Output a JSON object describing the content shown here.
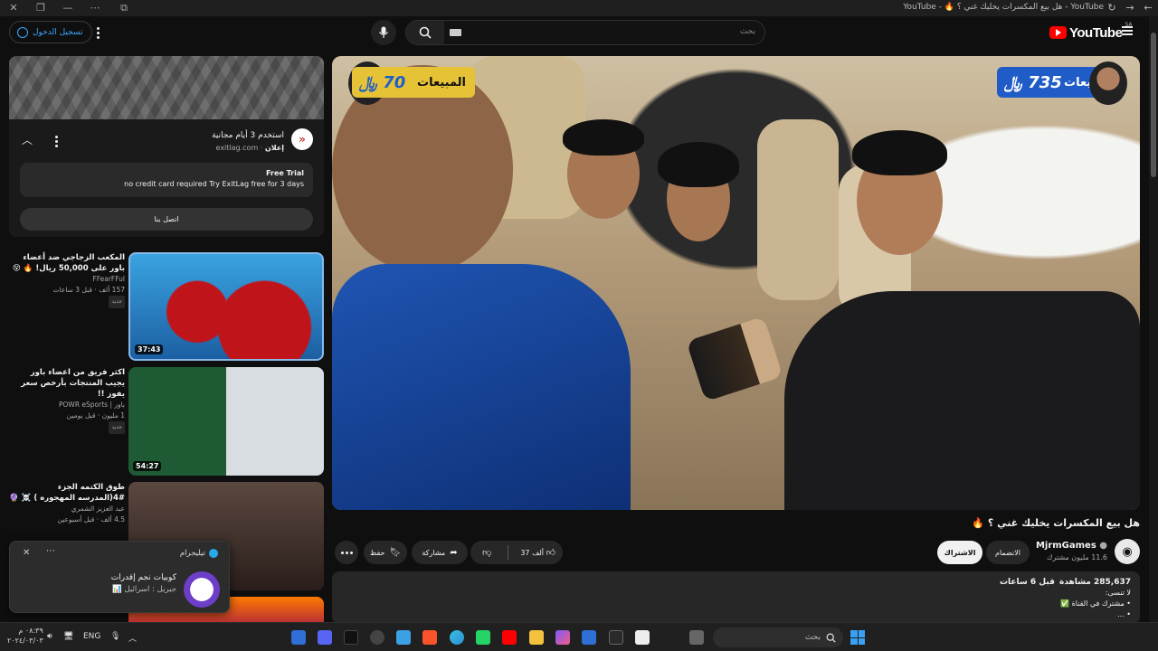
{
  "browser": {
    "tab_title": "YouTube - هل بيع المكسرات يخليك غني ؟ 🔥 - YouTube"
  },
  "masthead": {
    "signin_label": "تسجيل الدخول",
    "search_placeholder": "بحث",
    "logo_text": "YouTube",
    "logo_region": "SA"
  },
  "ad": {
    "headline": "استخدم 3 أيام مجانية",
    "sponsor_prefix": "إعلان",
    "domain": "exitlag.com",
    "trial_title": "Free Trial",
    "trial_text": "no credit card required Try ExitLag free for 3 days",
    "cta_label": "اتصل بنا"
  },
  "related": [
    {
      "title": "المكعب الزجاجي ضد أعضاء باور على 50,000 ريال! 🔥 😵",
      "channel": "FFearFFul",
      "views": "157 ألف",
      "age": "قبل 3 ساعات",
      "badge": "جديد",
      "duration": "37:43"
    },
    {
      "title": "اكثر فريق من اعضاء باور يجيب المنتجات بأرخص سعر يفوز !!",
      "channel": "باور | POWR eSports",
      "views": "1 مليون",
      "age": "قبل يومين",
      "badge": "جديد",
      "duration": "54:27"
    },
    {
      "title": "طوق الكتمه الجزء #4(المدرسه المهجوره ) ☠️ 🔮",
      "channel": "عبد العزيز الشمري",
      "views": "4.5 ألف",
      "age": "قبل أسبوعين",
      "badge": "",
      "duration": ""
    }
  ],
  "toast": {
    "app": "تيليجرام",
    "title": "كوبيات نجم إقدرات",
    "subtitle": "جبريل : اسرائيل 📊"
  },
  "player": {
    "sales_label_left": "المبيعات",
    "sales_value_left": "70",
    "sales_label_right": "المبيعات",
    "sales_value_right": "735",
    "currency": "﷼"
  },
  "video": {
    "title": "هل بيع المكسرات يخليك غني ؟ 🔥",
    "channel_name": "MjrmGames",
    "subscribers": "11.6 مليون مشترك",
    "join_label": "الانضمام",
    "subscribe_label": "الاشتراك",
    "likes": "37 ألف",
    "share_label": "مشاركة",
    "save_label": "حفظ"
  },
  "description": {
    "views": "285,637 مشاهدة",
    "age": "قبل 6 ساعات",
    "line1": "لا تنسى:",
    "line2": "• مشترك في القناة ✅",
    "line3": "• ..."
  },
  "taskbar": {
    "time": "٠٨:٣٩ م",
    "date": "٢٠٢٤/٠٣/٠٣",
    "lang": "ENG",
    "search_placeholder": "بحث"
  }
}
